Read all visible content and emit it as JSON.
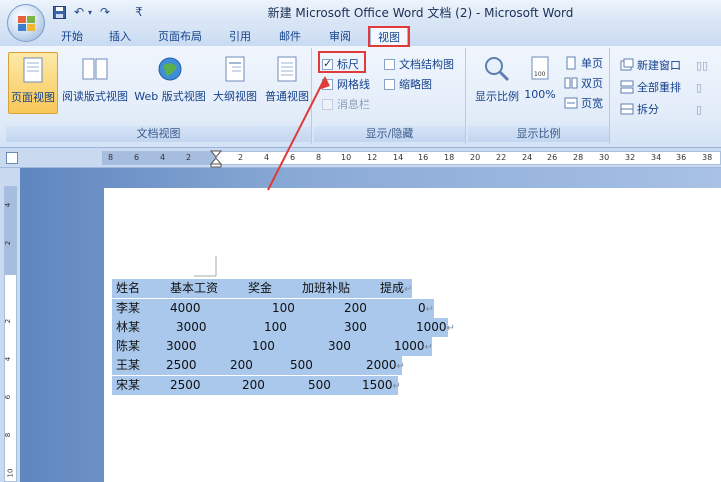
{
  "window": {
    "title": "新建 Microsoft Office Word 文档 (2) - Microsoft Word"
  },
  "quick_access": {
    "save_icon": "save-icon",
    "undo_icon": "undo-icon",
    "customize_glyph": "₹"
  },
  "tabs": [
    {
      "label": "开始"
    },
    {
      "label": "插入"
    },
    {
      "label": "页面布局"
    },
    {
      "label": "引用"
    },
    {
      "label": "邮件"
    },
    {
      "label": "审阅"
    },
    {
      "label": "视图",
      "active": true
    }
  ],
  "ribbon": {
    "doc_views": {
      "label": "文档视图",
      "buttons": [
        {
          "label": "页面视图",
          "selected": true
        },
        {
          "label": "阅读版式视图"
        },
        {
          "label": "Web 版式视图"
        },
        {
          "label": "大纲视图"
        },
        {
          "label": "普通视图"
        }
      ]
    },
    "show_hide": {
      "label": "显示/隐藏",
      "ruler": {
        "label": "标尺",
        "checked": true
      },
      "gridlines": {
        "label": "网格线",
        "checked": false
      },
      "message_bar": {
        "label": "消息栏",
        "checked": false,
        "disabled": true
      },
      "doc_map": {
        "label": "文档结构图",
        "checked": false
      },
      "thumbnails": {
        "label": "缩略图",
        "checked": false
      }
    },
    "zoom": {
      "label": "显示比例",
      "zoom_button": "显示比例",
      "percent_button": "100%",
      "one_page": "单页",
      "two_pages": "双页",
      "page_width": "页宽"
    },
    "window_group": {
      "new_window": "新建窗口",
      "arrange_all": "全部重排",
      "split": "拆分"
    }
  },
  "ruler": {
    "ticks": [
      "8",
      "6",
      "4",
      "2",
      "2",
      "4",
      "6",
      "8",
      "10",
      "12",
      "14",
      "16",
      "18",
      "20",
      "22",
      "24",
      "26",
      "28",
      "30",
      "32",
      "34",
      "36",
      "38"
    ],
    "vticks": [
      "4",
      "2",
      "2",
      "4",
      "6",
      "8",
      "10"
    ]
  },
  "document": {
    "rows": [
      {
        "cells": [
          "姓名",
          "基本工资",
          "奖金",
          "加班补贴",
          "提成"
        ],
        "mark": "↵"
      },
      {
        "cells": [
          "李某",
          "4000",
          "100",
          "200",
          "0"
        ],
        "mark": "↵"
      },
      {
        "cells": [
          "林某",
          "3000",
          "100",
          "300",
          "1000"
        ],
        "mark": "↵"
      },
      {
        "cells": [
          "陈某",
          "3000",
          "100",
          "300",
          "1000"
        ],
        "mark": "↵"
      },
      {
        "cells": [
          "王某",
          "2500",
          "200",
          "500",
          "2000"
        ],
        "mark": "↵"
      },
      {
        "cells": [
          "宋某",
          "2500",
          "200",
          "500",
          "1500"
        ],
        "mark": "↵"
      }
    ]
  },
  "annotation_color": "#e03a3a",
  "selection_color": "#a9c8ec"
}
